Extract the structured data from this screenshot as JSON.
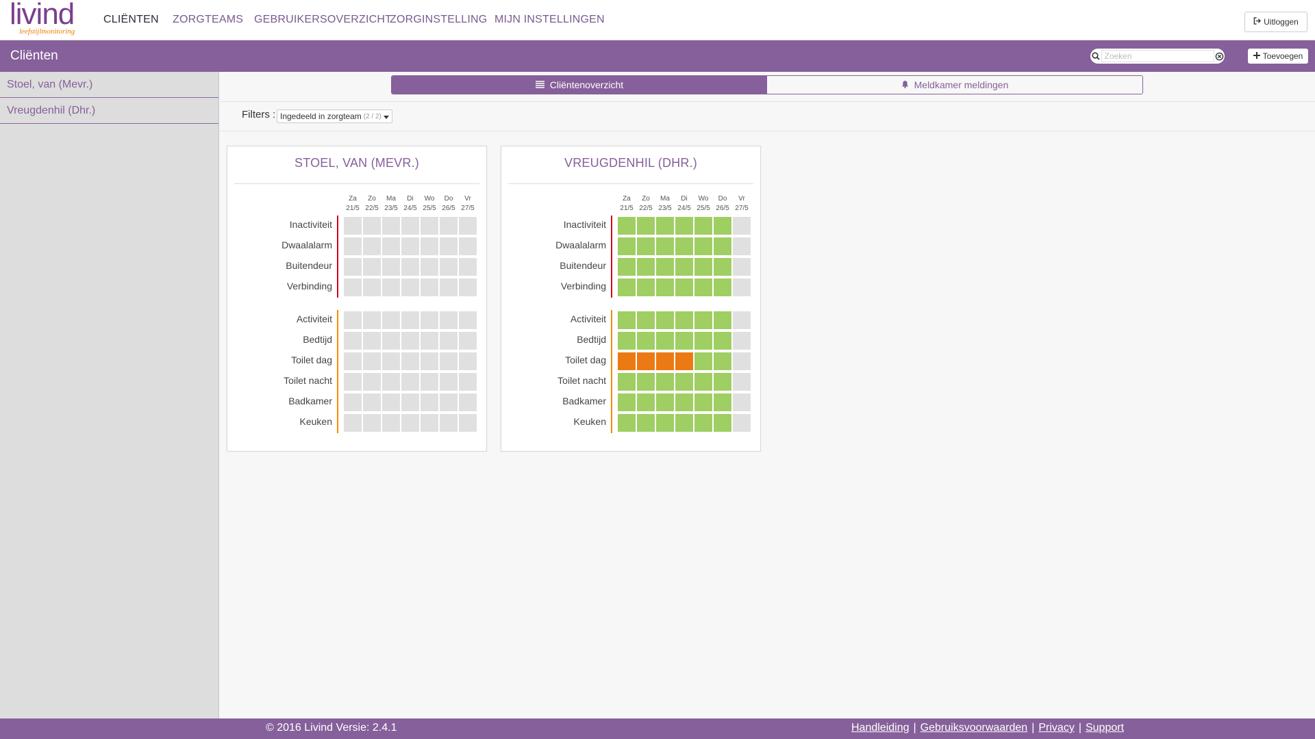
{
  "brand": {
    "logo_text": "livind",
    "logo_subtext": "leefstijlmonitoring"
  },
  "nav": {
    "items": [
      {
        "label": "CLIËNTEN",
        "active": true
      },
      {
        "label": "ZORGTEAMS",
        "active": false
      },
      {
        "label": "GEBRUIKERSOVERZICHT",
        "active": false
      },
      {
        "label": "ZORGINSTELLING",
        "active": false
      },
      {
        "label": "MIJN INSTELLINGEN",
        "active": false
      }
    ],
    "logout_label": "Uitloggen"
  },
  "subbar": {
    "title": "Cliënten",
    "search_placeholder": "Zoeken",
    "add_label": "Toevoegen"
  },
  "sidebar": {
    "items": [
      {
        "label": "Stoel, van (Mevr.)"
      },
      {
        "label": "Vreugdenhil (Dhr.)"
      }
    ]
  },
  "tabs": [
    {
      "label": "Cliëntenoverzicht",
      "active": true,
      "icon": "list-icon"
    },
    {
      "label": "Meldkamer meldingen",
      "active": false,
      "icon": "bell-icon"
    }
  ],
  "filters": {
    "label": "Filters :",
    "selected": "Ingedeeld in zorgteam",
    "count": "(2 / 2)"
  },
  "days": [
    {
      "day": "Za",
      "date": "21/5"
    },
    {
      "day": "Zo",
      "date": "22/5"
    },
    {
      "day": "Ma",
      "date": "23/5"
    },
    {
      "day": "Di",
      "date": "24/5"
    },
    {
      "day": "Wo",
      "date": "25/5"
    },
    {
      "day": "Do",
      "date": "26/5"
    },
    {
      "day": "Vr",
      "date": "27/5"
    }
  ],
  "colors": {
    "accent": "#86609a",
    "status_none": "#e0e0e0",
    "status_ok": "#9fce63",
    "status_alert": "#ec7a14",
    "group_alarm_line": "#d0021b",
    "group_activity_line": "#f08c00"
  },
  "clients": [
    {
      "name": "STOEL, VAN (MEVR.)",
      "groups": [
        {
          "rows": [
            {
              "label": "Inactiviteit",
              "status": [
                "none",
                "none",
                "none",
                "none",
                "none",
                "none",
                "none"
              ]
            },
            {
              "label": "Dwaalalarm",
              "status": [
                "none",
                "none",
                "none",
                "none",
                "none",
                "none",
                "none"
              ]
            },
            {
              "label": "Buitendeur",
              "status": [
                "none",
                "none",
                "none",
                "none",
                "none",
                "none",
                "none"
              ]
            },
            {
              "label": "Verbinding",
              "status": [
                "none",
                "none",
                "none",
                "none",
                "none",
                "none",
                "none"
              ]
            }
          ]
        },
        {
          "rows": [
            {
              "label": "Activiteit",
              "status": [
                "none",
                "none",
                "none",
                "none",
                "none",
                "none",
                "none"
              ]
            },
            {
              "label": "Bedtijd",
              "status": [
                "none",
                "none",
                "none",
                "none",
                "none",
                "none",
                "none"
              ]
            },
            {
              "label": "Toilet dag",
              "status": [
                "none",
                "none",
                "none",
                "none",
                "none",
                "none",
                "none"
              ]
            },
            {
              "label": "Toilet nacht",
              "status": [
                "none",
                "none",
                "none",
                "none",
                "none",
                "none",
                "none"
              ]
            },
            {
              "label": "Badkamer",
              "status": [
                "none",
                "none",
                "none",
                "none",
                "none",
                "none",
                "none"
              ]
            },
            {
              "label": "Keuken",
              "status": [
                "none",
                "none",
                "none",
                "none",
                "none",
                "none",
                "none"
              ]
            }
          ]
        }
      ]
    },
    {
      "name": "VREUGDENHIL (DHR.)",
      "groups": [
        {
          "rows": [
            {
              "label": "Inactiviteit",
              "status": [
                "ok",
                "ok",
                "ok",
                "ok",
                "ok",
                "ok",
                "none"
              ]
            },
            {
              "label": "Dwaalalarm",
              "status": [
                "ok",
                "ok",
                "ok",
                "ok",
                "ok",
                "ok",
                "none"
              ]
            },
            {
              "label": "Buitendeur",
              "status": [
                "ok",
                "ok",
                "ok",
                "ok",
                "ok",
                "ok",
                "none"
              ]
            },
            {
              "label": "Verbinding",
              "status": [
                "ok",
                "ok",
                "ok",
                "ok",
                "ok",
                "ok",
                "none"
              ]
            }
          ]
        },
        {
          "rows": [
            {
              "label": "Activiteit",
              "status": [
                "ok",
                "ok",
                "ok",
                "ok",
                "ok",
                "ok",
                "none"
              ]
            },
            {
              "label": "Bedtijd",
              "status": [
                "ok",
                "ok",
                "ok",
                "ok",
                "ok",
                "ok",
                "none"
              ]
            },
            {
              "label": "Toilet dag",
              "status": [
                "alert",
                "alert",
                "alert",
                "alert",
                "ok",
                "ok",
                "none"
              ]
            },
            {
              "label": "Toilet nacht",
              "status": [
                "ok",
                "ok",
                "ok",
                "ok",
                "ok",
                "ok",
                "none"
              ]
            },
            {
              "label": "Badkamer",
              "status": [
                "ok",
                "ok",
                "ok",
                "ok",
                "ok",
                "ok",
                "none"
              ]
            },
            {
              "label": "Keuken",
              "status": [
                "ok",
                "ok",
                "ok",
                "ok",
                "ok",
                "ok",
                "none"
              ]
            }
          ]
        }
      ]
    }
  ],
  "footer": {
    "copyright": "© 2016 Livind Versie: 2.4.1",
    "links": [
      "Handleiding",
      "Gebruiksvoorwaarden",
      "Privacy",
      "Support"
    ],
    "separator": "|"
  }
}
